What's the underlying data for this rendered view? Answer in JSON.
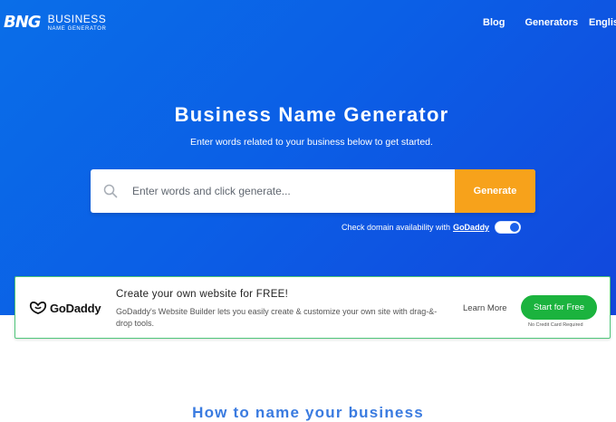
{
  "brand": {
    "mark": "BNG",
    "line1": "BUSINESS",
    "line2": "NAME GENERATOR"
  },
  "nav": {
    "items": [
      "Blog",
      "Generators"
    ],
    "language": "English"
  },
  "hero": {
    "title": "Business Name Generator",
    "subtitle": "Enter words related to your business below to get started."
  },
  "search": {
    "placeholder": "Enter words and click generate...",
    "button": "Generate",
    "icon": "search-icon"
  },
  "domain_check": {
    "text": "Check domain availability with",
    "provider": "GoDaddy",
    "enabled": true
  },
  "ad": {
    "logo": "GoDaddy",
    "title": "Create your own website for FREE!",
    "description": "GoDaddy's Website Builder lets you easily create & customize your own site with drag-&-drop tools.",
    "learn_more": "Learn More",
    "cta": "Start for Free",
    "cta_note": "No Credit Card Required"
  },
  "section": {
    "heading": "How to name your business"
  },
  "colors": {
    "hero": "#0b5fe6",
    "generate": "#f7a21b",
    "cta": "#1bb33e",
    "heading": "#3a7be0"
  }
}
